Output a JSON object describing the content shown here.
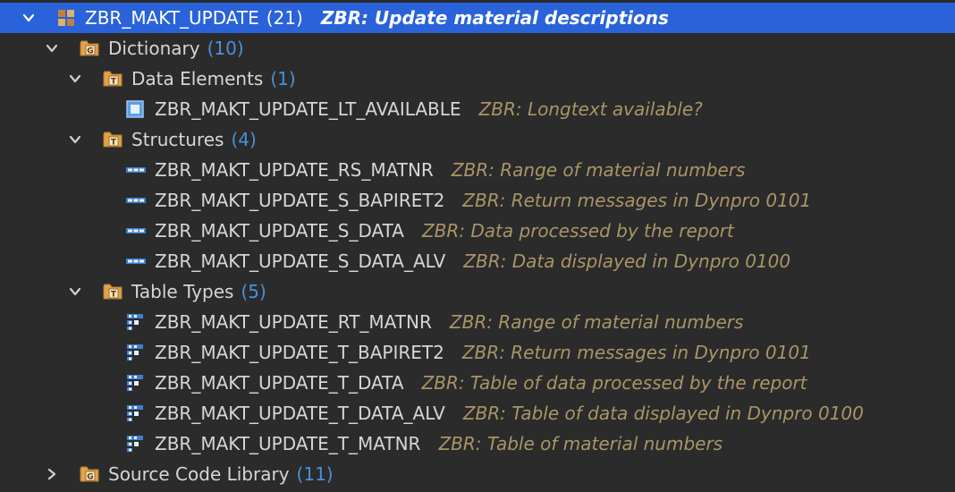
{
  "tree": {
    "root": {
      "name": "ZBR_MAKT_UPDATE",
      "count": "(21)",
      "desc": "ZBR: Update material descriptions",
      "icon": "package-icon"
    },
    "dictionary": {
      "name": "Dictionary",
      "count": "(10)",
      "icon": "folder-g-icon"
    },
    "data_elements": {
      "name": "Data Elements",
      "count": "(1)",
      "icon": "folder-t-icon"
    },
    "de_items": [
      {
        "name": "ZBR_MAKT_UPDATE_LT_AVAILABLE",
        "desc": "ZBR: Longtext available?",
        "icon": "data-element-icon"
      }
    ],
    "structures": {
      "name": "Structures",
      "count": "(4)",
      "icon": "folder-t-icon"
    },
    "structure_items": [
      {
        "name": "ZBR_MAKT_UPDATE_RS_MATNR",
        "desc": "ZBR: Range of material numbers",
        "icon": "structure-icon"
      },
      {
        "name": "ZBR_MAKT_UPDATE_S_BAPIRET2",
        "desc": "ZBR: Return messages in Dynpro 0101",
        "icon": "structure-icon"
      },
      {
        "name": "ZBR_MAKT_UPDATE_S_DATA",
        "desc": "ZBR: Data processed by the report",
        "icon": "structure-icon"
      },
      {
        "name": "ZBR_MAKT_UPDATE_S_DATA_ALV",
        "desc": "ZBR: Data displayed in Dynpro 0100",
        "icon": "structure-icon"
      }
    ],
    "table_types": {
      "name": "Table Types",
      "count": "(5)",
      "icon": "folder-t-icon"
    },
    "table_type_items": [
      {
        "name": "ZBR_MAKT_UPDATE_RT_MATNR",
        "desc": "ZBR: Range of material numbers",
        "icon": "table-type-icon"
      },
      {
        "name": "ZBR_MAKT_UPDATE_T_BAPIRET2",
        "desc": "ZBR: Return messages in Dynpro 0101",
        "icon": "table-type-icon"
      },
      {
        "name": "ZBR_MAKT_UPDATE_T_DATA",
        "desc": "ZBR: Table of data processed by the report",
        "icon": "table-type-icon"
      },
      {
        "name": "ZBR_MAKT_UPDATE_T_DATA_ALV",
        "desc": "ZBR: Table of data displayed in Dynpro 0100",
        "icon": "table-type-icon"
      },
      {
        "name": "ZBR_MAKT_UPDATE_T_MATNR",
        "desc": "ZBR: Table of material numbers",
        "icon": "table-type-icon"
      }
    ],
    "source_code_library": {
      "name": "Source Code Library",
      "count": "(11)",
      "icon": "folder-g-icon"
    }
  },
  "colors": {
    "background": "#2b2b2b",
    "selection": "#2962d9",
    "text": "#d6d6d6",
    "count": "#4a90d9",
    "description": "#a99566"
  }
}
